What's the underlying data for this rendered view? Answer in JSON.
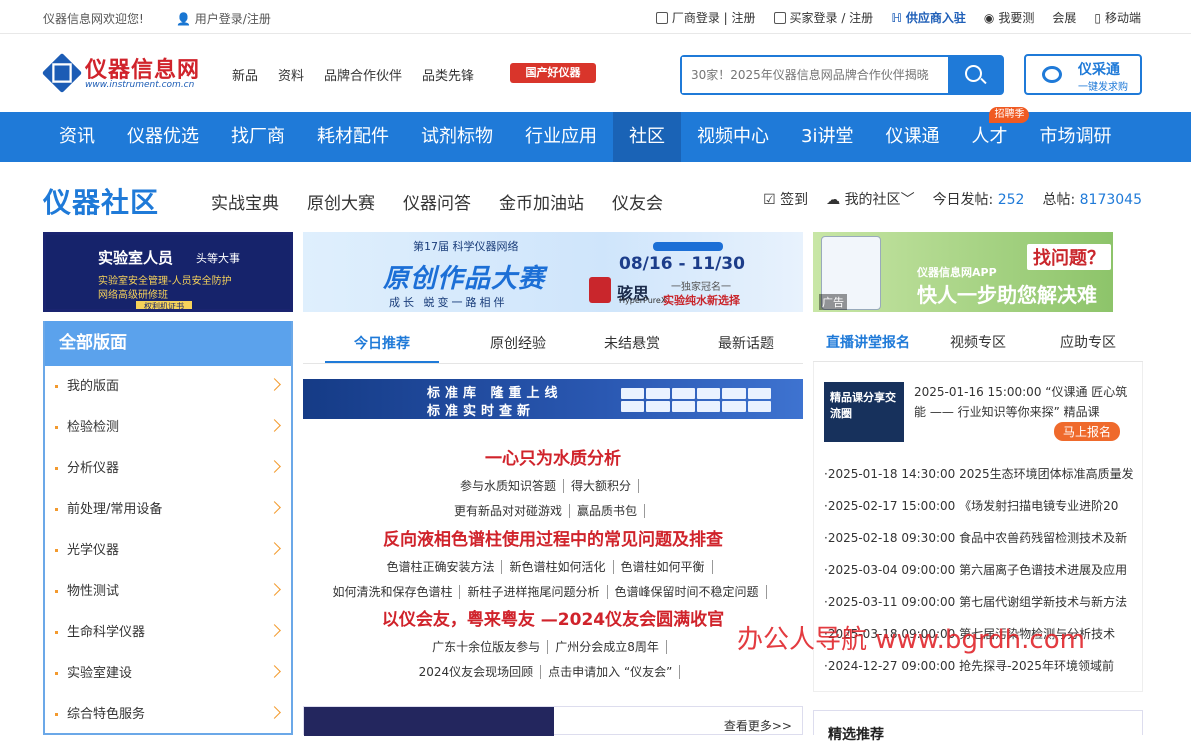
{
  "topbar": {
    "welcome": "仪器信息网欢迎您!",
    "login": "用户登录/注册",
    "links": [
      {
        "icon": "factory-icon",
        "label": "厂商登录 | 注册"
      },
      {
        "icon": "buyer-icon",
        "label": "买家登录 / 注册"
      },
      {
        "icon": "supplier-icon",
        "label": "供应商入驻"
      },
      {
        "icon": "self-test-icon",
        "label": "我要测"
      },
      {
        "icon": "exhibition-icon",
        "label": "会展"
      },
      {
        "icon": "mobile-icon",
        "label": "移动端"
      }
    ]
  },
  "header": {
    "logo_name": "仪器信息网",
    "logo_url": "www.instrument.com.cn",
    "nav": [
      "新品",
      "资料",
      "品牌合作伙伴",
      "品类先锋"
    ],
    "badge": "国产好仪器",
    "search_placeholder": "30家！2025年仪器信息网品牌合作伙伴揭晓",
    "ycg_title": "仪采通",
    "ycg_sub": "一键发求购"
  },
  "mainnav": {
    "items": [
      "资讯",
      "仪器优选",
      "找厂商",
      "耗材配件",
      "试剂标物",
      "行业应用",
      "社区",
      "视频中心",
      "3i讲堂",
      "仪课通",
      "人才",
      "市场调研"
    ],
    "active_index": 6,
    "hire_badge": "招聘季"
  },
  "community": {
    "title": "仪器社区",
    "nav": [
      "实战宝典",
      "原创大赛",
      "仪器问答",
      "金币加油站",
      "仪友会"
    ],
    "signin": "签到",
    "my_community": "我的社区",
    "today_label": "今日发帖:",
    "today_count": "252",
    "total_label": "总帖:",
    "total_count": "8173045"
  },
  "banners": {
    "b1": {
      "t1": "实验室人员",
      "t2": "头等大事",
      "t3": "实验室安全管理-人员安全防护",
      "t4": "网络高级研修班",
      "tag": "权利机证书"
    },
    "b2": {
      "a": "第17届 科学仪器网络",
      "b": "原创作品大赛",
      "c": "成长 蜕变一路相伴",
      "d": "08/16 - 11/30",
      "e": "骇思",
      "f": "一独家冠名一",
      "g": "实验纯水新选择",
      "h": "HyperPureX"
    },
    "b3": {
      "ad": "广告",
      "t1": "仪器信息网APP",
      "t2": "快人一步助您解决难题",
      "t3": "找问题？"
    }
  },
  "sidebar": {
    "title": "全部版面",
    "items": [
      "我的版面",
      "检验检测",
      "分析仪器",
      "前处理/常用设备",
      "光学仪器",
      "物性测试",
      "生命科学仪器",
      "实验室建设",
      "综合特色服务"
    ]
  },
  "center": {
    "tabs": [
      "今日推荐",
      "原创经验",
      "未结悬赏",
      "最新话题"
    ],
    "banner": {
      "line1": "标准库 隆重上线",
      "line2": "标准实时查新"
    },
    "topics": [
      {
        "title": "一心只为水质分析",
        "lines": [
          [
            "参与水质知识答题",
            "得大额积分"
          ],
          [
            "更有新品对对碰游戏",
            "赢品质书包"
          ]
        ]
      },
      {
        "title": "反向液相色谱柱使用过程中的常见问题及排查",
        "lines": [
          [
            "色谱柱正确安装方法",
            "新色谱柱如何活化",
            "色谱柱如何平衡"
          ],
          [
            "如何清洗和保存色谱柱",
            "新柱子进样拖尾问题分析",
            "色谱峰保留时间不稳定问题"
          ]
        ]
      },
      {
        "title": "以仪会友，粤来粤友 —2024仪友会圆满收官",
        "lines": [
          [
            "广东十余位版友参与",
            "广州分会成立8周年"
          ],
          [
            "2024仪友会现场回顾",
            "点击申请加入 “仪友会”"
          ]
        ]
      }
    ],
    "more": "查看更多>>"
  },
  "right": {
    "tabs": [
      "直播讲堂报名",
      "视频专区",
      "应助专区"
    ],
    "feature_img": "精品课分享交流圈",
    "feature_text": "2025-01-16 15:00:00 “仪课通 匠心筑能 —— 行业知识等你来探” 精品课",
    "signup": "马上报名",
    "list": [
      "·2025-01-18 14:30:00 2025生态环境团体标准高质量发",
      "·2025-02-17 15:00:00 《场发射扫描电镜专业进阶20",
      "·2025-02-18 09:30:00 食品中农兽药残留检测技术及新",
      "·2025-03-04 09:00:00 第六届离子色谱技术进展及应用",
      "·2025-03-11 09:00:00 第七届代谢组学新技术与新方法",
      "·2025-03-18 09:00:00 第七届污染物检测与分析技术",
      "·2024-12-27 09:00:00 抢先探寻-2025年环境领域前"
    ],
    "box2_title": "精选推荐"
  },
  "watermark": "办公人导航 www.bgrdh.com"
}
